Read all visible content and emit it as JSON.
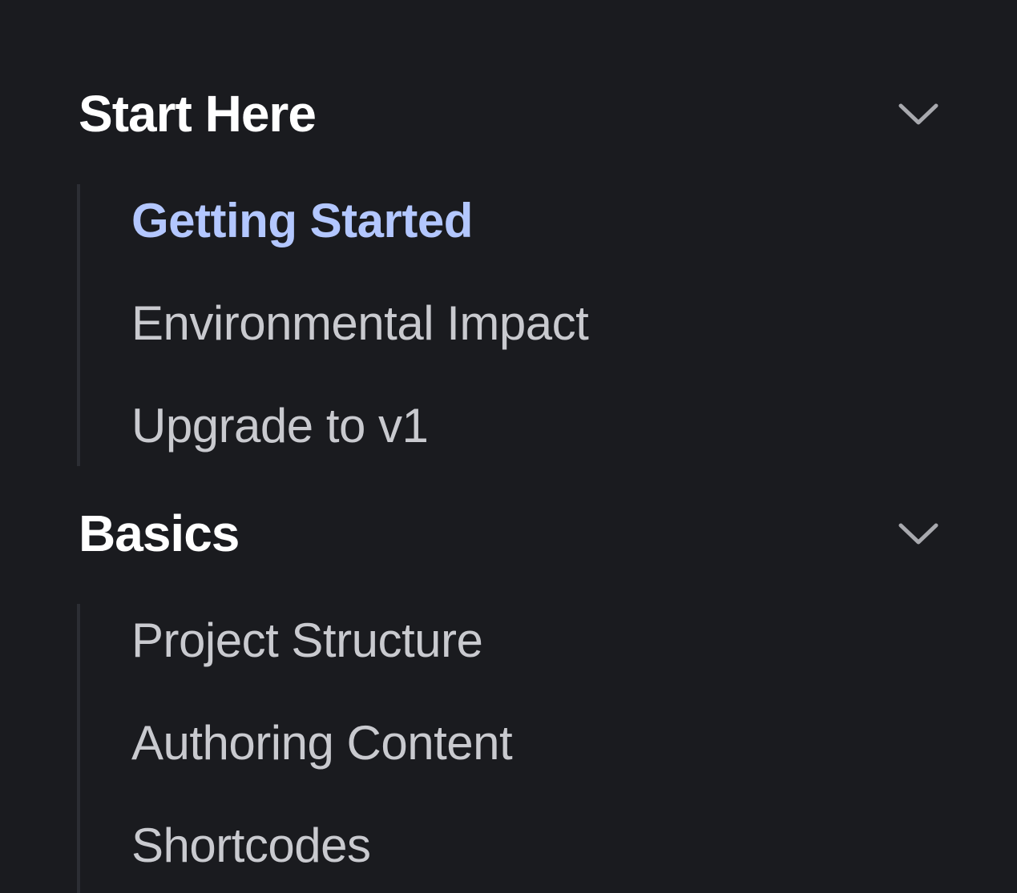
{
  "sidebar": {
    "groups": [
      {
        "title": "Start Here",
        "expanded_icon": "chevron-down-icon",
        "items": [
          {
            "label": "Getting Started",
            "active": true
          },
          {
            "label": "Environmental Impact",
            "active": false
          },
          {
            "label": "Upgrade to v1",
            "active": false
          }
        ]
      },
      {
        "title": "Basics",
        "expanded_icon": "chevron-down-icon",
        "items": [
          {
            "label": "Project Structure",
            "active": false
          },
          {
            "label": "Authoring Content",
            "active": false
          },
          {
            "label": "Shortcodes",
            "active": false
          }
        ]
      }
    ]
  },
  "colors": {
    "background": "#1a1b1f",
    "heading": "#ffffff",
    "item": "#c9cacf",
    "active_item": "#b3c7ff",
    "chevron": "#a8a9ae",
    "guide_line": "#2c2e34"
  }
}
